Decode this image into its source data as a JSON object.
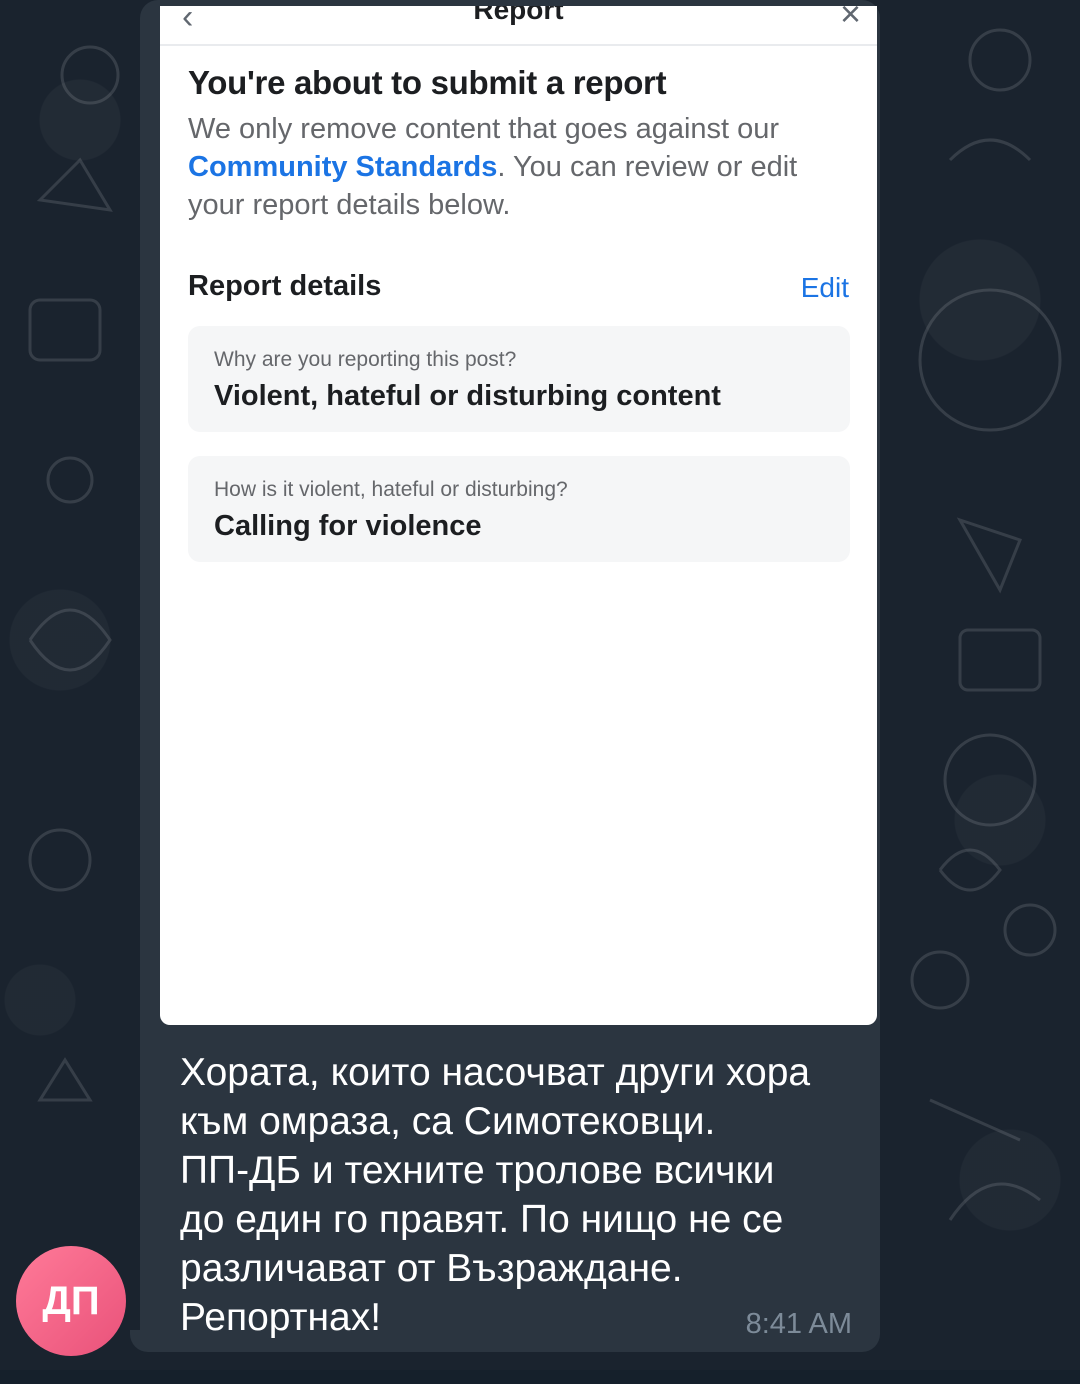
{
  "report_sheet": {
    "header_title": "Report",
    "title": "You're about to submit a report",
    "description_prefix": "We only remove content that goes against our ",
    "description_link": "Community Standards",
    "description_suffix": ". You can review or edit your report details below.",
    "details_label": "Report details",
    "edit_label": "Edit",
    "cards": [
      {
        "question": "Why are you reporting this post?",
        "answer": "Violent, hateful or disturbing content"
      },
      {
        "question": "How is it violent, hateful or disturbing?",
        "answer": "Calling for violence"
      }
    ]
  },
  "message": {
    "text_lines": [
      "Хората, които насочват други хора",
      "към омраза, са Симотековци.",
      "ПП-ДБ и техните тролове всички",
      "до един го правят. По нищо не се",
      "различават от Възраждане.",
      "Репортнах!"
    ],
    "time": "8:41 AM",
    "sender_initials": "ДП"
  },
  "colors": {
    "chat_background": "#1a232e",
    "bubble": "#2b3540",
    "link": "#1b74e4",
    "avatar": "#ec5f82"
  }
}
